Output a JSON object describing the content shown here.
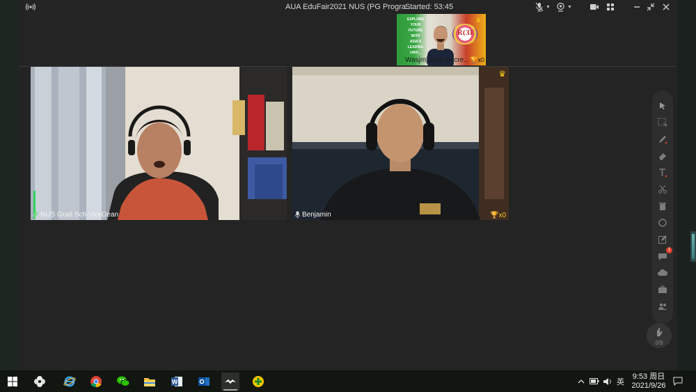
{
  "window": {
    "title": "AUA EduFair2021 NUS (PG Progra...",
    "started": "Started: 53:45"
  },
  "thumbnail": {
    "name": "Wasjm[ AUA Secre...",
    "trophy": "x0",
    "banner_lines": [
      "EXPLORE",
      "YOUR",
      "FUTURE",
      "WITH",
      "ASIA'S",
      "LEADING",
      "UNIV..."
    ],
    "logo_text": "R(3E"
  },
  "tiles": [
    {
      "name": "NUS Grad Sch ViceDean"
    },
    {
      "name": "Benjamin",
      "trophy": "x0"
    }
  ],
  "toolbar": {
    "chat_badge": "1",
    "raise_hand_count": "0/9"
  },
  "taskbar": {
    "ime": "英",
    "time": "9:53 周日",
    "date": "2021/9/26"
  },
  "colors": {
    "crown": "#f5c518",
    "app_bg": "#242424",
    "badge": "#e0432f"
  }
}
